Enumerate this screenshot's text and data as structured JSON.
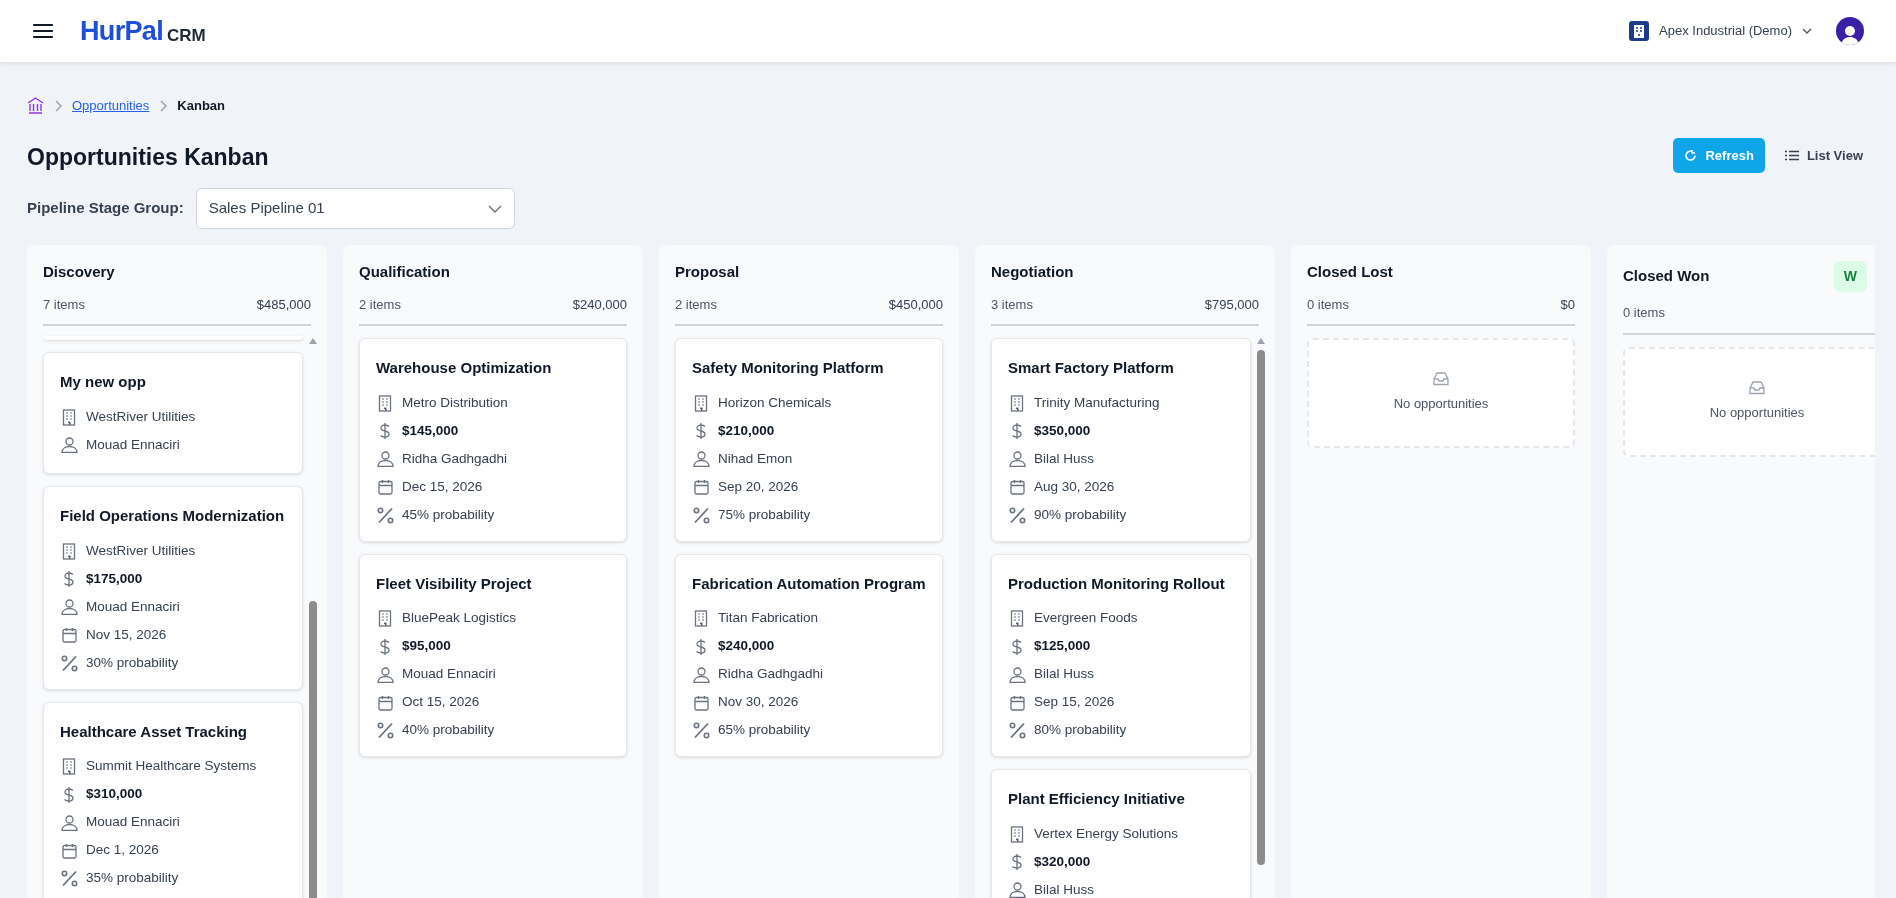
{
  "header": {
    "logo_main": "HurPal",
    "logo_sub": "CRM",
    "organization": "Apex Industrial (Demo)"
  },
  "breadcrumb": [
    {
      "label": "Opportunities",
      "kind": "link"
    },
    {
      "label": "Kanban",
      "kind": "current"
    }
  ],
  "page_title": "Opportunities Kanban",
  "actions": [
    {
      "label": "Refresh",
      "kind": "primary"
    },
    {
      "label": "List View",
      "kind": "plain"
    }
  ],
  "pipeline_filter": {
    "label": "Pipeline Stage Group:",
    "value": "Sales Pipeline 01"
  },
  "columns": [
    {
      "title": "Discovery",
      "count": "7 items",
      "total": "$485,000",
      "scrollbar": true,
      "scrolled": true,
      "cards": [
        {
          "title": "My new opp",
          "rows": [
            {
              "kind": "company",
              "text": "WestRiver Utilities"
            },
            {
              "kind": "owner",
              "text": "Mouad Ennaciri"
            }
          ]
        },
        {
          "title": "Field Operations Modernization",
          "rows": [
            {
              "kind": "company",
              "text": "WestRiver Utilities"
            },
            {
              "kind": "amount",
              "text": "$175,000"
            },
            {
              "kind": "owner",
              "text": "Mouad Ennaciri"
            },
            {
              "kind": "date",
              "text": "Nov 15, 2026"
            },
            {
              "kind": "probability",
              "text": "30% probability"
            }
          ]
        },
        {
          "title": "Healthcare Asset Tracking",
          "rows": [
            {
              "kind": "company",
              "text": "Summit Healthcare Systems"
            },
            {
              "kind": "amount",
              "text": "$310,000"
            },
            {
              "kind": "owner",
              "text": "Mouad Ennaciri"
            },
            {
              "kind": "date",
              "text": "Dec 1, 2026"
            },
            {
              "kind": "probability",
              "text": "35% probability"
            }
          ]
        }
      ]
    },
    {
      "title": "Qualification",
      "count": "2 items",
      "total": "$240,000",
      "scrollbar": false,
      "scrolled": false,
      "cards": [
        {
          "title": "Warehouse Optimization",
          "rows": [
            {
              "kind": "company",
              "text": "Metro Distribution"
            },
            {
              "kind": "amount",
              "text": "$145,000"
            },
            {
              "kind": "owner",
              "text": "Ridha Gadhgadhi"
            },
            {
              "kind": "date",
              "text": "Dec 15, 2026"
            },
            {
              "kind": "probability",
              "text": "45% probability"
            }
          ]
        },
        {
          "title": "Fleet Visibility Project",
          "rows": [
            {
              "kind": "company",
              "text": "BluePeak Logistics"
            },
            {
              "kind": "amount",
              "text": "$95,000"
            },
            {
              "kind": "owner",
              "text": "Mouad Ennaciri"
            },
            {
              "kind": "date",
              "text": "Oct 15, 2026"
            },
            {
              "kind": "probability",
              "text": "40% probability"
            }
          ]
        }
      ]
    },
    {
      "title": "Proposal",
      "count": "2 items",
      "total": "$450,000",
      "scrollbar": false,
      "scrolled": false,
      "cards": [
        {
          "title": "Safety Monitoring Platform",
          "rows": [
            {
              "kind": "company",
              "text": "Horizon Chemicals"
            },
            {
              "kind": "amount",
              "text": "$210,000"
            },
            {
              "kind": "owner",
              "text": "Nihad Emon"
            },
            {
              "kind": "date",
              "text": "Sep 20, 2026"
            },
            {
              "kind": "probability",
              "text": "75% probability"
            }
          ]
        },
        {
          "title": "Fabrication Automation Program",
          "rows": [
            {
              "kind": "company",
              "text": "Titan Fabrication"
            },
            {
              "kind": "amount",
              "text": "$240,000"
            },
            {
              "kind": "owner",
              "text": "Ridha Gadhgadhi"
            },
            {
              "kind": "date",
              "text": "Nov 30, 2026"
            },
            {
              "kind": "probability",
              "text": "65% probability"
            }
          ]
        }
      ]
    },
    {
      "title": "Negotiation",
      "count": "3 items",
      "total": "$795,000",
      "scrollbar": true,
      "scrolled": false,
      "cards": [
        {
          "title": "Smart Factory Platform",
          "rows": [
            {
              "kind": "company",
              "text": "Trinity Manufacturing"
            },
            {
              "kind": "amount",
              "text": "$350,000"
            },
            {
              "kind": "owner",
              "text": "Bilal Huss"
            },
            {
              "kind": "date",
              "text": "Aug 30, 2026"
            },
            {
              "kind": "probability",
              "text": "90% probability"
            }
          ]
        },
        {
          "title": "Production Monitoring Rollout",
          "rows": [
            {
              "kind": "company",
              "text": "Evergreen Foods"
            },
            {
              "kind": "amount",
              "text": "$125,000"
            },
            {
              "kind": "owner",
              "text": "Bilal Huss"
            },
            {
              "kind": "date",
              "text": "Sep 15, 2026"
            },
            {
              "kind": "probability",
              "text": "80% probability"
            }
          ]
        },
        {
          "title": "Plant Efficiency Initiative",
          "rows": [
            {
              "kind": "company",
              "text": "Vertex Energy Solutions"
            },
            {
              "kind": "amount",
              "text": "$320,000"
            },
            {
              "kind": "owner",
              "text": "Bilal Huss"
            }
          ]
        }
      ]
    },
    {
      "title": "Closed Lost",
      "count": "0 items",
      "total": "$0",
      "scrollbar": false,
      "scrolled": false,
      "empty_text": "No opportunities"
    },
    {
      "title": "Closed Won",
      "badge": "W",
      "count": "0 items",
      "scrollbar": false,
      "scrolled": false,
      "empty_text": "No opportunities"
    }
  ]
}
